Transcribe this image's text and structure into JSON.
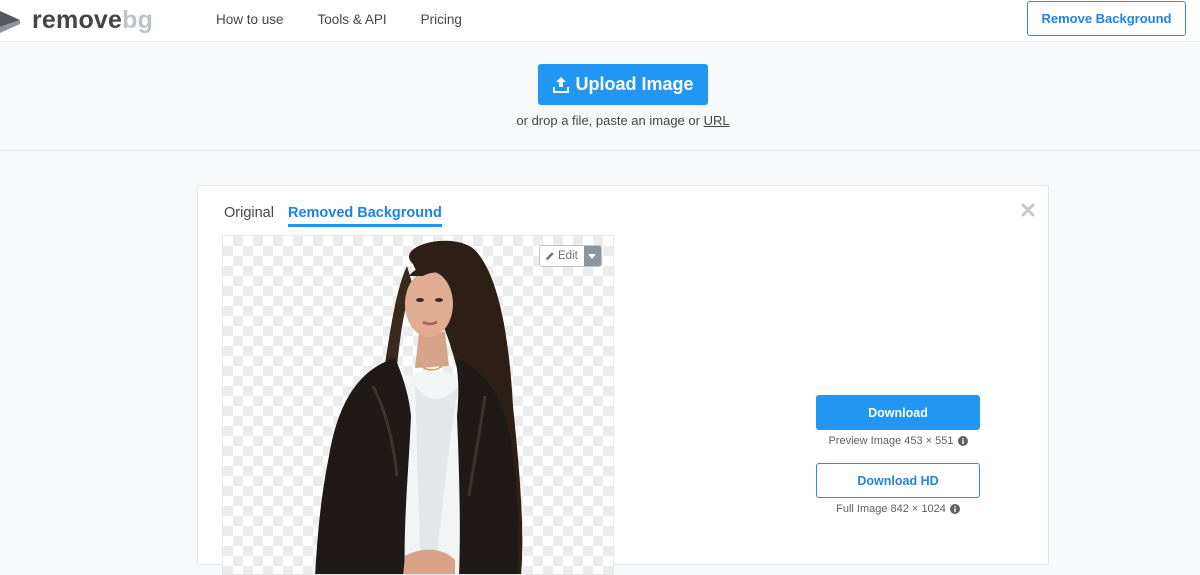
{
  "logo": {
    "word_main": "remove",
    "word_accent": "bg"
  },
  "nav": {
    "links": [
      "How to use",
      "Tools & API",
      "Pricing"
    ],
    "cta": "Remove Background"
  },
  "upload": {
    "button": "Upload Image",
    "hint_prefix": "or drop a file, paste an image or ",
    "hint_link": "URL"
  },
  "result": {
    "tabs": [
      {
        "label": "Original",
        "active": false
      },
      {
        "label": "Removed Background",
        "active": true
      }
    ],
    "edit_label": "Edit",
    "download": {
      "label": "Download",
      "caption": "Preview Image 453 × 551"
    },
    "download_hd": {
      "label": "Download HD",
      "caption": "Full Image 842 × 1024"
    }
  },
  "colors": {
    "accent": "#2196f3",
    "text": "#454545",
    "logo_muted": "#bfc3c7",
    "checker": "#ececec"
  }
}
